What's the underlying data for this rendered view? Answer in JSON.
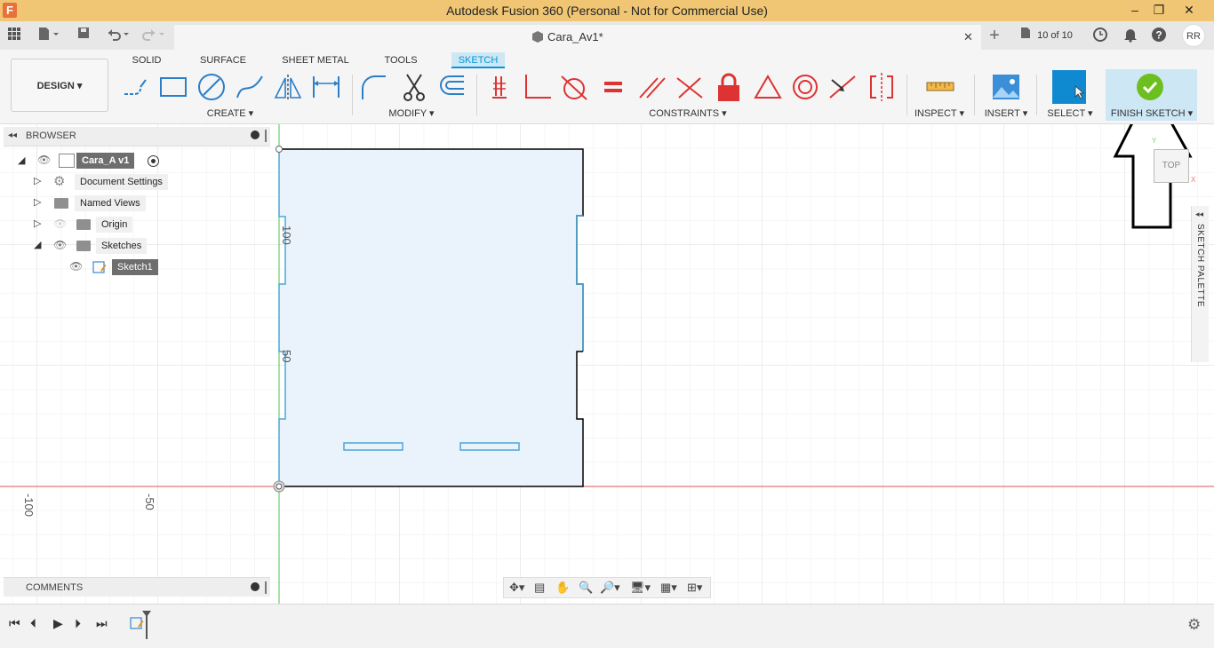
{
  "titlebar": {
    "logo": "F",
    "title": "Autodesk Fusion 360 (Personal - Not for Commercial Use)",
    "minimize": "–",
    "restore": "❐",
    "close": "✕"
  },
  "quickbar": {
    "doc_tab_label": "Cara_Av1*",
    "tab_close": "✕",
    "new_tab": "+",
    "job_status": "10 of 10",
    "user_initials": "RR"
  },
  "toolbar": {
    "workspace": "DESIGN ▾",
    "tabs": [
      "SOLID",
      "SURFACE",
      "SHEET METAL",
      "TOOLS",
      "SKETCH"
    ],
    "groups": {
      "create": "CREATE ▾",
      "modify": "MODIFY ▾",
      "constraints": "CONSTRAINTS ▾",
      "inspect": "INSPECT ▾",
      "insert": "INSERT ▾",
      "select": "SELECT ▾",
      "finish": "FINISH SKETCH ▾"
    },
    "accent": "#0696d7",
    "finish_color": "#6cbf1f"
  },
  "browser": {
    "title": "BROWSER",
    "root": "Cara_A v1",
    "items": [
      {
        "label": "Document Settings",
        "icon": "gear-icon"
      },
      {
        "label": "Named Views",
        "icon": "folder-icon"
      },
      {
        "label": "Origin",
        "icon": "folder-icon"
      },
      {
        "label": "Sketches",
        "icon": "folder-icon"
      },
      {
        "label": "Sketch1",
        "icon": "sketch-icon"
      }
    ]
  },
  "comments": {
    "title": "COMMENTS"
  },
  "canvas": {
    "dim_labels": [
      "100",
      "50"
    ],
    "axis_labels": [
      "-100",
      "-50"
    ],
    "viewcube_label": "TOP",
    "sketch_palette": "SKETCH PALETTE"
  }
}
